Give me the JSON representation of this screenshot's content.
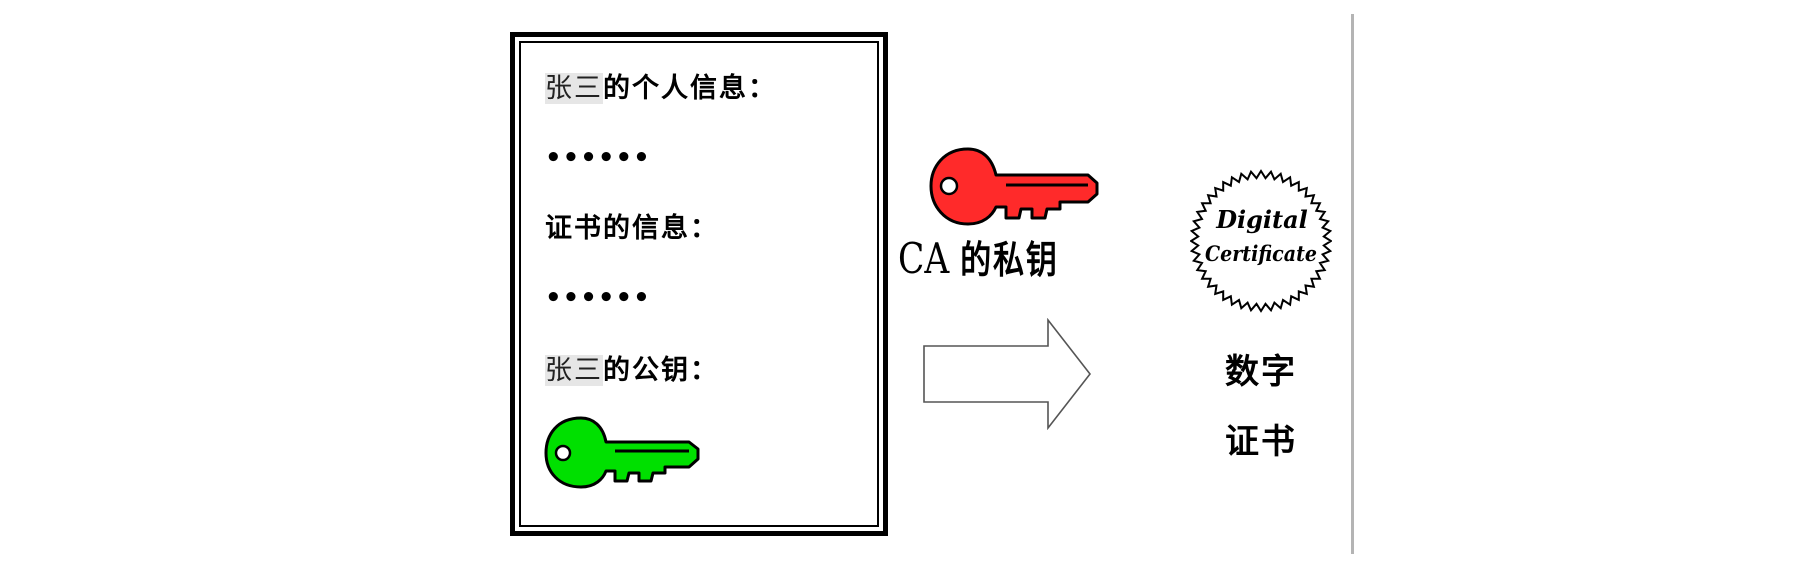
{
  "card": {
    "owner_name_1": "张三",
    "personal_info_label": "的个人信息：",
    "ellipsis_1": "••••••",
    "cert_info_label": "证书的信息：",
    "ellipsis_2": "••••••",
    "owner_name_2": "张三",
    "public_key_label": "的公钥：",
    "public_key_icon": "key-icon",
    "public_key_color": "#00e000"
  },
  "ca": {
    "prefix": "CA",
    "private_key_label": "的私钥",
    "private_key_icon": "key-icon",
    "private_key_color": "#ff2a2a"
  },
  "arrow": {
    "icon": "right-arrow-icon"
  },
  "certificate": {
    "seal_line_1": "Digital",
    "seal_line_2": "Certificate",
    "label_line_1": "数字",
    "label_line_2": "证书"
  }
}
